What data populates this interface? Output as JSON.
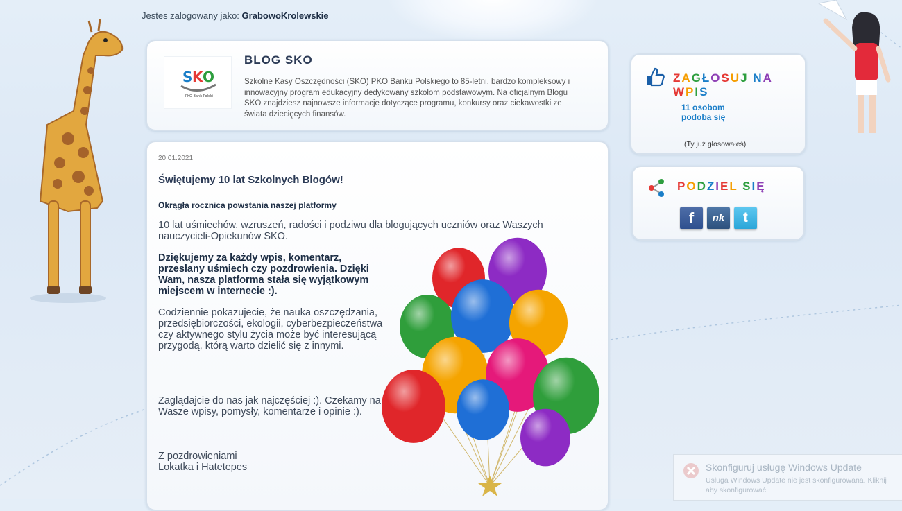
{
  "header": {
    "login_prefix": "Jestes zalogowany jako:",
    "username": "GrabowoKrolewskie"
  },
  "blog": {
    "logo_text": "SKO",
    "logo_subtext": "PKO Bank Polski",
    "title": "BLOG SKO",
    "description": "Szkolne Kasy Oszczędności (SKO) PKO Banku Polskiego to 85-letni, bardzo kompleksowy i innowacyjny program edukacyjny dedykowany szkołom podstawowym. Na oficjalnym Blogu SKO znajdziesz najnowsze informacje dotyczące programu, konkursy oraz ciekawostki ze świata dziecięcych finansów."
  },
  "post": {
    "date": "20.01.2021",
    "title": "Świętujemy 10 lat Szkolnych Blogów!",
    "subtitle": "Okrągła rocznica powstania naszej platformy",
    "paragraph1": "10 lat uśmiechów, wzruszeń, radości i podziwu dla blogujących uczniów oraz  Waszych nauczycieli-Opiekunów SKO.",
    "paragraph2": "Dziękujemy za każdy wpis, komentarz, przesłany uśmiech czy pozdrowienia. Dzięki Wam, nasza platforma stała się wyjątkowym miejscem w internecie :).",
    "paragraph3": "Codziennie pokazujecie, że nauka oszczędzania, przedsiębiorczości, ekologii, cyberbezpieczeństwa czy aktywnego stylu życia może być interesującą przygodą, którą warto dzielić się z innymi.",
    "paragraph4": "Zaglądajcie do nas jak najczęściej :). Czekamy na Wasze wpisy, pomysły, komentarze i opinie :).",
    "greeting": "Z pozdrowieniami",
    "signature": "Lokatka i Hatetepes"
  },
  "vote": {
    "title": "ZAGŁOSUJ NA WPIS",
    "count_line1": "11 osobom",
    "count_line2": "podoba się",
    "note": "(Ty już głosowałeś)"
  },
  "share": {
    "title": "PODZIEL SIĘ",
    "buttons": [
      {
        "label": "f",
        "icon": "facebook-icon"
      },
      {
        "label": "nk",
        "icon": "nk-icon"
      },
      {
        "label": "t",
        "icon": "twitter-icon"
      }
    ]
  },
  "colors": {
    "title_letters": [
      "#e53935",
      "#f59d00",
      "#2e9e3f",
      "#1a7ec8",
      "#8e3fb5",
      "#e53935",
      "#f59d00",
      "#2e9e3f",
      "#1a7ec8",
      "#8e3fb5",
      "#e53935",
      "#f59d00",
      "#2e9e3f",
      "#1a7ec8",
      "#8e3fb5",
      "#e53935"
    ],
    "link_blue": "#1a7ec8",
    "balloon_colors": [
      "#e0262a",
      "#f5a400",
      "#2f9e3b",
      "#1f6fd6",
      "#8d2bc4",
      "#e5197a"
    ]
  },
  "notification": {
    "title": "Skonfiguruj usługę Windows Update",
    "text_line1": "Usługa Windows Update nie jest skonfigurowana. Kliknij",
    "text_line2": "aby skonfigurować."
  }
}
